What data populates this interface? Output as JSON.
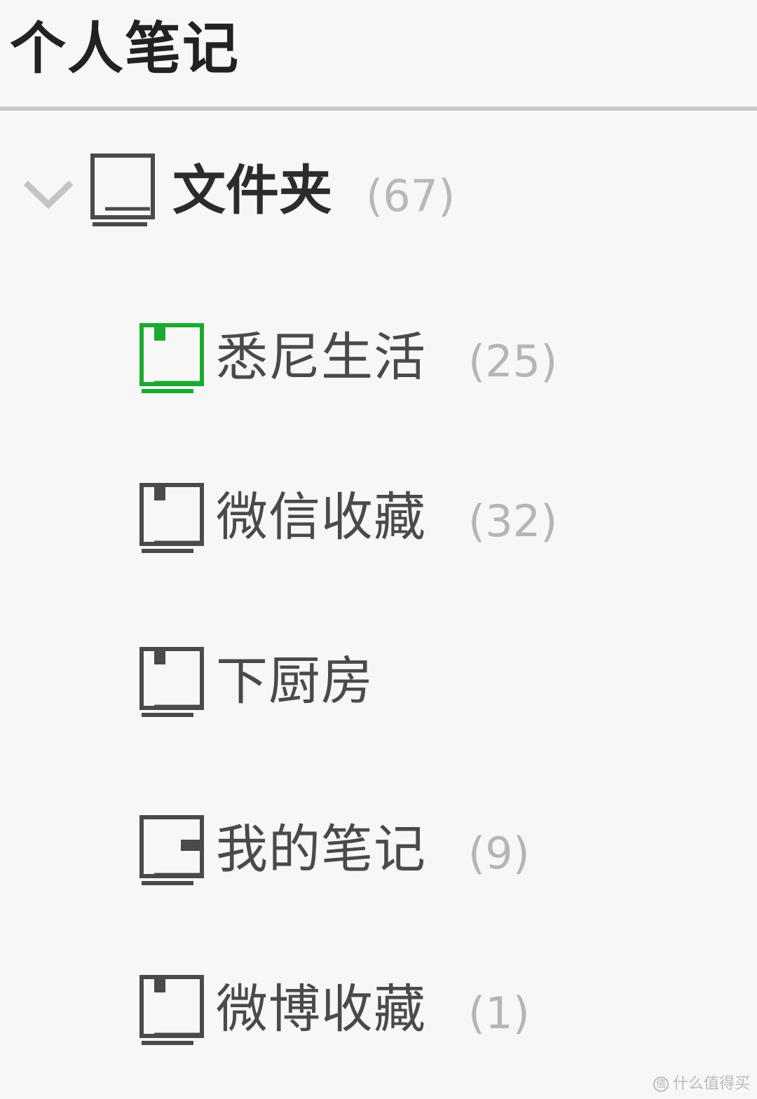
{
  "header": {
    "title": "个人笔记"
  },
  "folder": {
    "label": "文件夹",
    "count": "(67)"
  },
  "notebooks": [
    {
      "label": "悉尼生活",
      "count": "(25)",
      "active": true
    },
    {
      "label": "微信收藏",
      "count": "(32)",
      "active": false
    },
    {
      "label": "下厨房",
      "count": "",
      "active": false
    },
    {
      "label": "我的笔记",
      "count": "(9)",
      "active": false
    },
    {
      "label": "微博收藏",
      "count": "(1)",
      "active": false
    }
  ],
  "colors": {
    "active_icon": "#1aaa2e",
    "icon": "#4a4a4a",
    "chevron": "#c4c4c4"
  },
  "watermark": {
    "text": "什么值得买",
    "symbol": "值"
  }
}
